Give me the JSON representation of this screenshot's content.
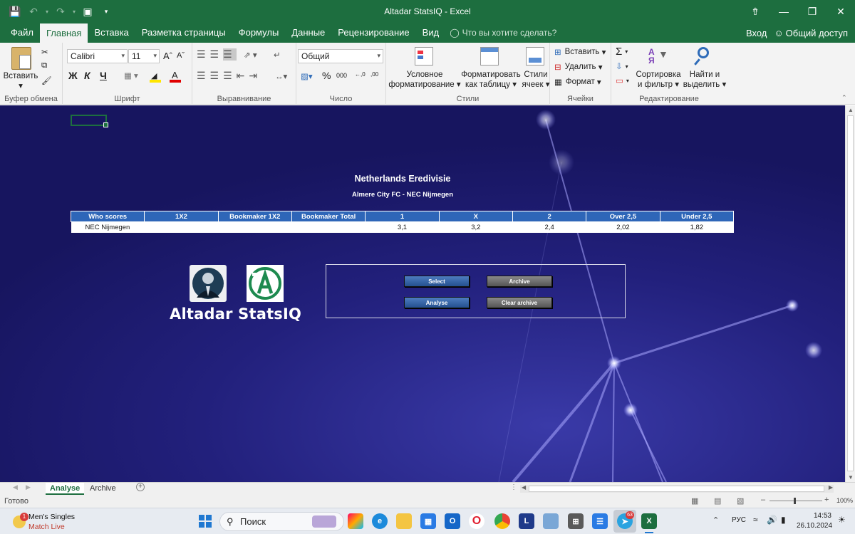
{
  "window": {
    "title": "Altadar StatsIQ  -  Excel"
  },
  "ribbon_tabs": {
    "file": "Файл",
    "home": "Главная",
    "insert": "Вставка",
    "layout": "Разметка страницы",
    "formulas": "Формулы",
    "data": "Данные",
    "review": "Рецензирование",
    "view": "Вид",
    "tell_me": "Что вы хотите сделать?",
    "signin": "Вход",
    "share": "Общий доступ"
  },
  "ribbon": {
    "clipboard": {
      "paste": "Вставить",
      "group": "Буфер обмена"
    },
    "font": {
      "name": "Calibri",
      "size": "11",
      "bold": "Ж",
      "italic": "К",
      "underline": "Ч",
      "group": "Шрифт"
    },
    "alignment": {
      "group": "Выравнивание"
    },
    "number": {
      "format": "Общий",
      "group": "Число"
    },
    "styles": {
      "conditional_1": "Условное",
      "conditional_2": "форматирование",
      "as_table_1": "Форматировать",
      "as_table_2": "как таблицу",
      "cell_styles_1": "Стили",
      "cell_styles_2": "ячеек",
      "group": "Стили"
    },
    "cells": {
      "insert": "Вставить",
      "delete": "Удалить",
      "format": "Формат",
      "group": "Ячейки"
    },
    "editing": {
      "sort_1": "Сортировка",
      "sort_2": "и фильтр",
      "find_1": "Найти и",
      "find_2": "выделить",
      "group": "Редактирование"
    }
  },
  "sheet": {
    "league": "Netherlands Eredivisie",
    "match": "Almere City FC - NEC Nijmegen",
    "table": {
      "headers": [
        "Who scores",
        "1X2",
        "Bookmaker 1X2",
        "Bookmaker Total",
        "1",
        "X",
        "2",
        "Over 2,5",
        "Under 2,5"
      ],
      "row": [
        "NEC Nijmegen",
        "",
        "",
        "",
        "3,1",
        "3,2",
        "2,4",
        "2,02",
        "1,82"
      ]
    },
    "brand": "Altadar StatsIQ",
    "buttons": {
      "select": "Select",
      "archive": "Archive",
      "analyse": "Analyse",
      "clear_archive": "Clear archive"
    }
  },
  "sheet_tabs": [
    "Analyse",
    "Archive"
  ],
  "status": {
    "ready": "Готово",
    "zoom": "100%"
  },
  "taskbar": {
    "notif_title": "Men's Singles",
    "notif_sub": "Match Live",
    "search": "Поиск",
    "lang": "РУС",
    "time": "14:53",
    "date": "26.10.2024",
    "telegram_badge": "63"
  }
}
